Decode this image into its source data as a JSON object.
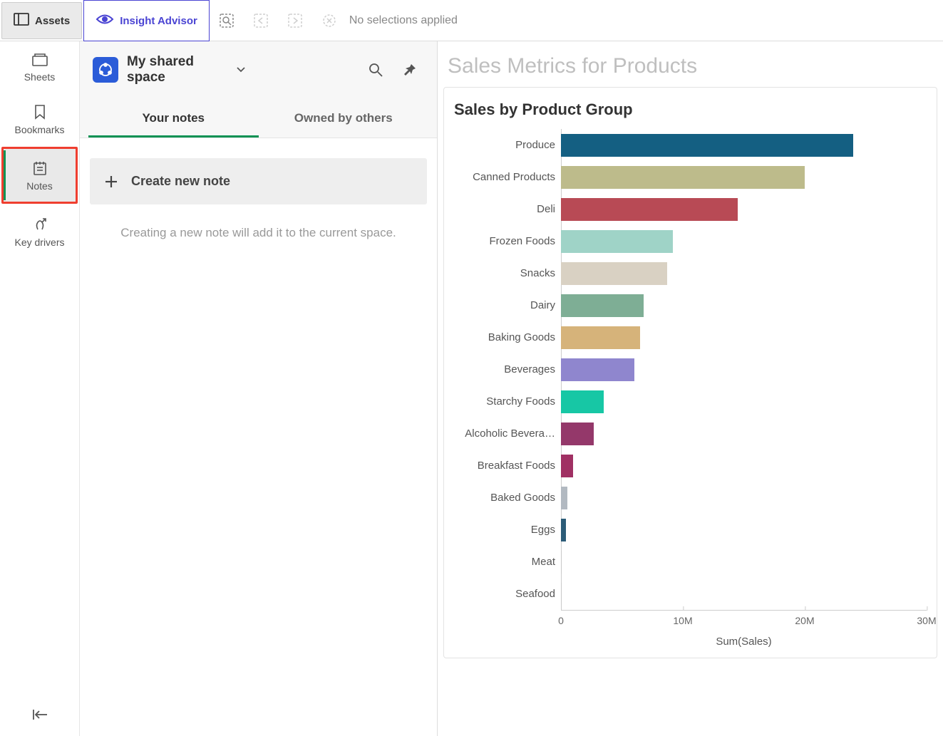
{
  "topbar": {
    "assets_label": "Assets",
    "insight_label": "Insight Advisor",
    "no_selection_text": "No selections applied"
  },
  "leftnav": {
    "sheets": "Sheets",
    "bookmarks": "Bookmarks",
    "notes": "Notes",
    "keydrivers": "Key drivers"
  },
  "notes_panel": {
    "space_title": "My shared space",
    "tabs": {
      "your_notes": "Your notes",
      "owned_by_others": "Owned by others"
    },
    "create_label": "Create new note",
    "hint": "Creating a new note will add it to the current space."
  },
  "chart_area": {
    "page_title": "Sales Metrics for Products",
    "card_title": "Sales by Product Group"
  },
  "chart_data": {
    "type": "bar",
    "orientation": "horizontal",
    "title": "Sales by Product Group",
    "xlabel": "Sum(Sales)",
    "ylabel": "",
    "xlim": [
      0,
      30000000
    ],
    "x_ticks": [
      0,
      10000000,
      20000000,
      30000000
    ],
    "x_tick_labels": [
      "0",
      "10M",
      "20M",
      "30M"
    ],
    "categories": [
      "Produce",
      "Canned Products",
      "Deli",
      "Frozen Foods",
      "Snacks",
      "Dairy",
      "Baking Goods",
      "Beverages",
      "Starchy Foods",
      "Alcoholic Bevera…",
      "Breakfast Foods",
      "Baked Goods",
      "Eggs",
      "Meat",
      "Seafood"
    ],
    "values": [
      24000000,
      20000000,
      14500000,
      9200000,
      8700000,
      6800000,
      6500000,
      6000000,
      3500000,
      2700000,
      1000000,
      500000,
      400000,
      80000,
      60000
    ],
    "colors": [
      "#145f82",
      "#bdbb8b",
      "#b84a55",
      "#9fd3c7",
      "#d9d1c3",
      "#7eae95",
      "#d6b37a",
      "#8f86ce",
      "#17c7a5",
      "#94386a",
      "#a03063",
      "#b2b9c1",
      "#2c5c78",
      "#c8c8c8",
      "#c8c8c8"
    ]
  }
}
